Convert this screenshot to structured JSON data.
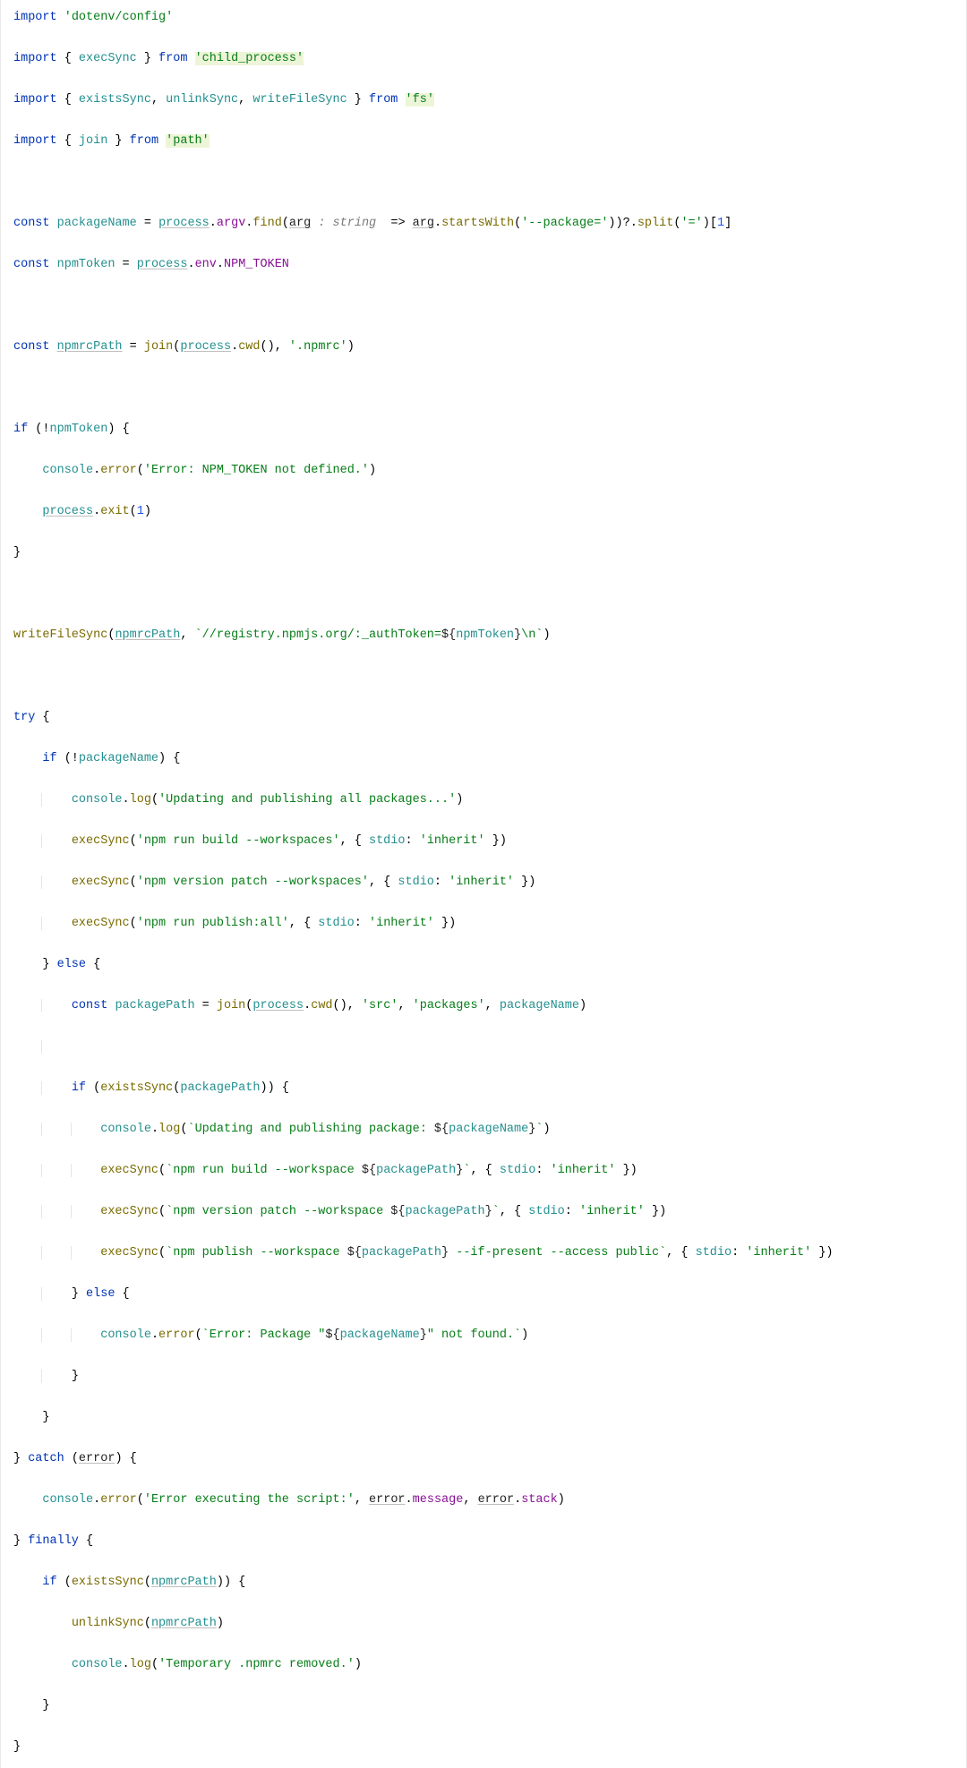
{
  "code": {
    "imports": {
      "dotenv": "'dotenv/config'",
      "execSync": "execSync",
      "child_process": "'child_process'",
      "existsSync": "existsSync",
      "unlinkSync": "unlinkSync",
      "writeFileSync": "writeFileSync",
      "fs": "'fs'",
      "join": "join",
      "path": "'path'"
    },
    "kw": {
      "import": "import",
      "from": "from",
      "const": "const",
      "if": "if",
      "else": "else",
      "try": "try",
      "catch": "catch",
      "finally": "finally"
    },
    "vars": {
      "packageName": "packageName",
      "npmToken": "npmToken",
      "npmrcPath": "npmrcPath",
      "packagePath": "packagePath",
      "arg": "arg",
      "error": "error"
    },
    "props": {
      "process": "process",
      "argv": "argv",
      "env": "env",
      "NPM_TOKEN": "NPM_TOKEN",
      "find": "find",
      "startsWith": "startsWith",
      "split": "split",
      "cwd": "cwd",
      "log": "log",
      "error": "error",
      "exit": "exit",
      "console": "console",
      "stdio": "stdio",
      "message": "message",
      "stack": "stack"
    },
    "typeHint": " : string ",
    "num1": "1",
    "strings": {
      "packageFlag": "'--package='",
      "eq": "'='",
      "npmrc": "'.npmrc'",
      "errTokenNotDefined": "'Error: NPM_TOKEN not defined.'",
      "registryPre": "`//registry.npmjs.org/:_authToken=",
      "registryPost": "\\n`",
      "updatingAll": "'Updating and publishing all packages...'",
      "buildWs": "'npm run build --workspaces'",
      "inherit": "'inherit'",
      "versionWs": "'npm version patch --workspaces'",
      "publishAll": "'npm run publish:all'",
      "src": "'src'",
      "packages": "'packages'",
      "updatingPkgPre": "`Updating and publishing package: ",
      "updatingPkgPost": "`",
      "buildOnePre": "`npm run build --workspace ",
      "buildOnePost": "`",
      "versionOnePre": "`npm version patch --workspace ",
      "versionOnePost": "`",
      "publishOnePre": "`npm publish --workspace ",
      "publishOnePost": " --if-present --access public`",
      "errPkgNotFoundPre": "`Error: Package \"",
      "errPkgNotFoundPost": "\" not found.`",
      "errExec": "'Error executing the script:'",
      "tempRemoved": "'Temporary .npmrc removed.'"
    }
  }
}
